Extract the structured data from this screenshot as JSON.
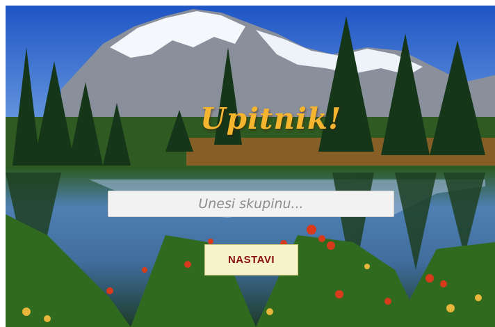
{
  "app": {
    "title": "Upitnik!"
  },
  "form": {
    "group_input": {
      "value": "",
      "placeholder": "Unesi skupinu..."
    },
    "continue_button_label": "NASTAVI"
  },
  "colors": {
    "title": "#f6b52f",
    "button_bg": "#f6f2c9",
    "button_text": "#8b1111",
    "input_bg": "#f2f2f2"
  }
}
